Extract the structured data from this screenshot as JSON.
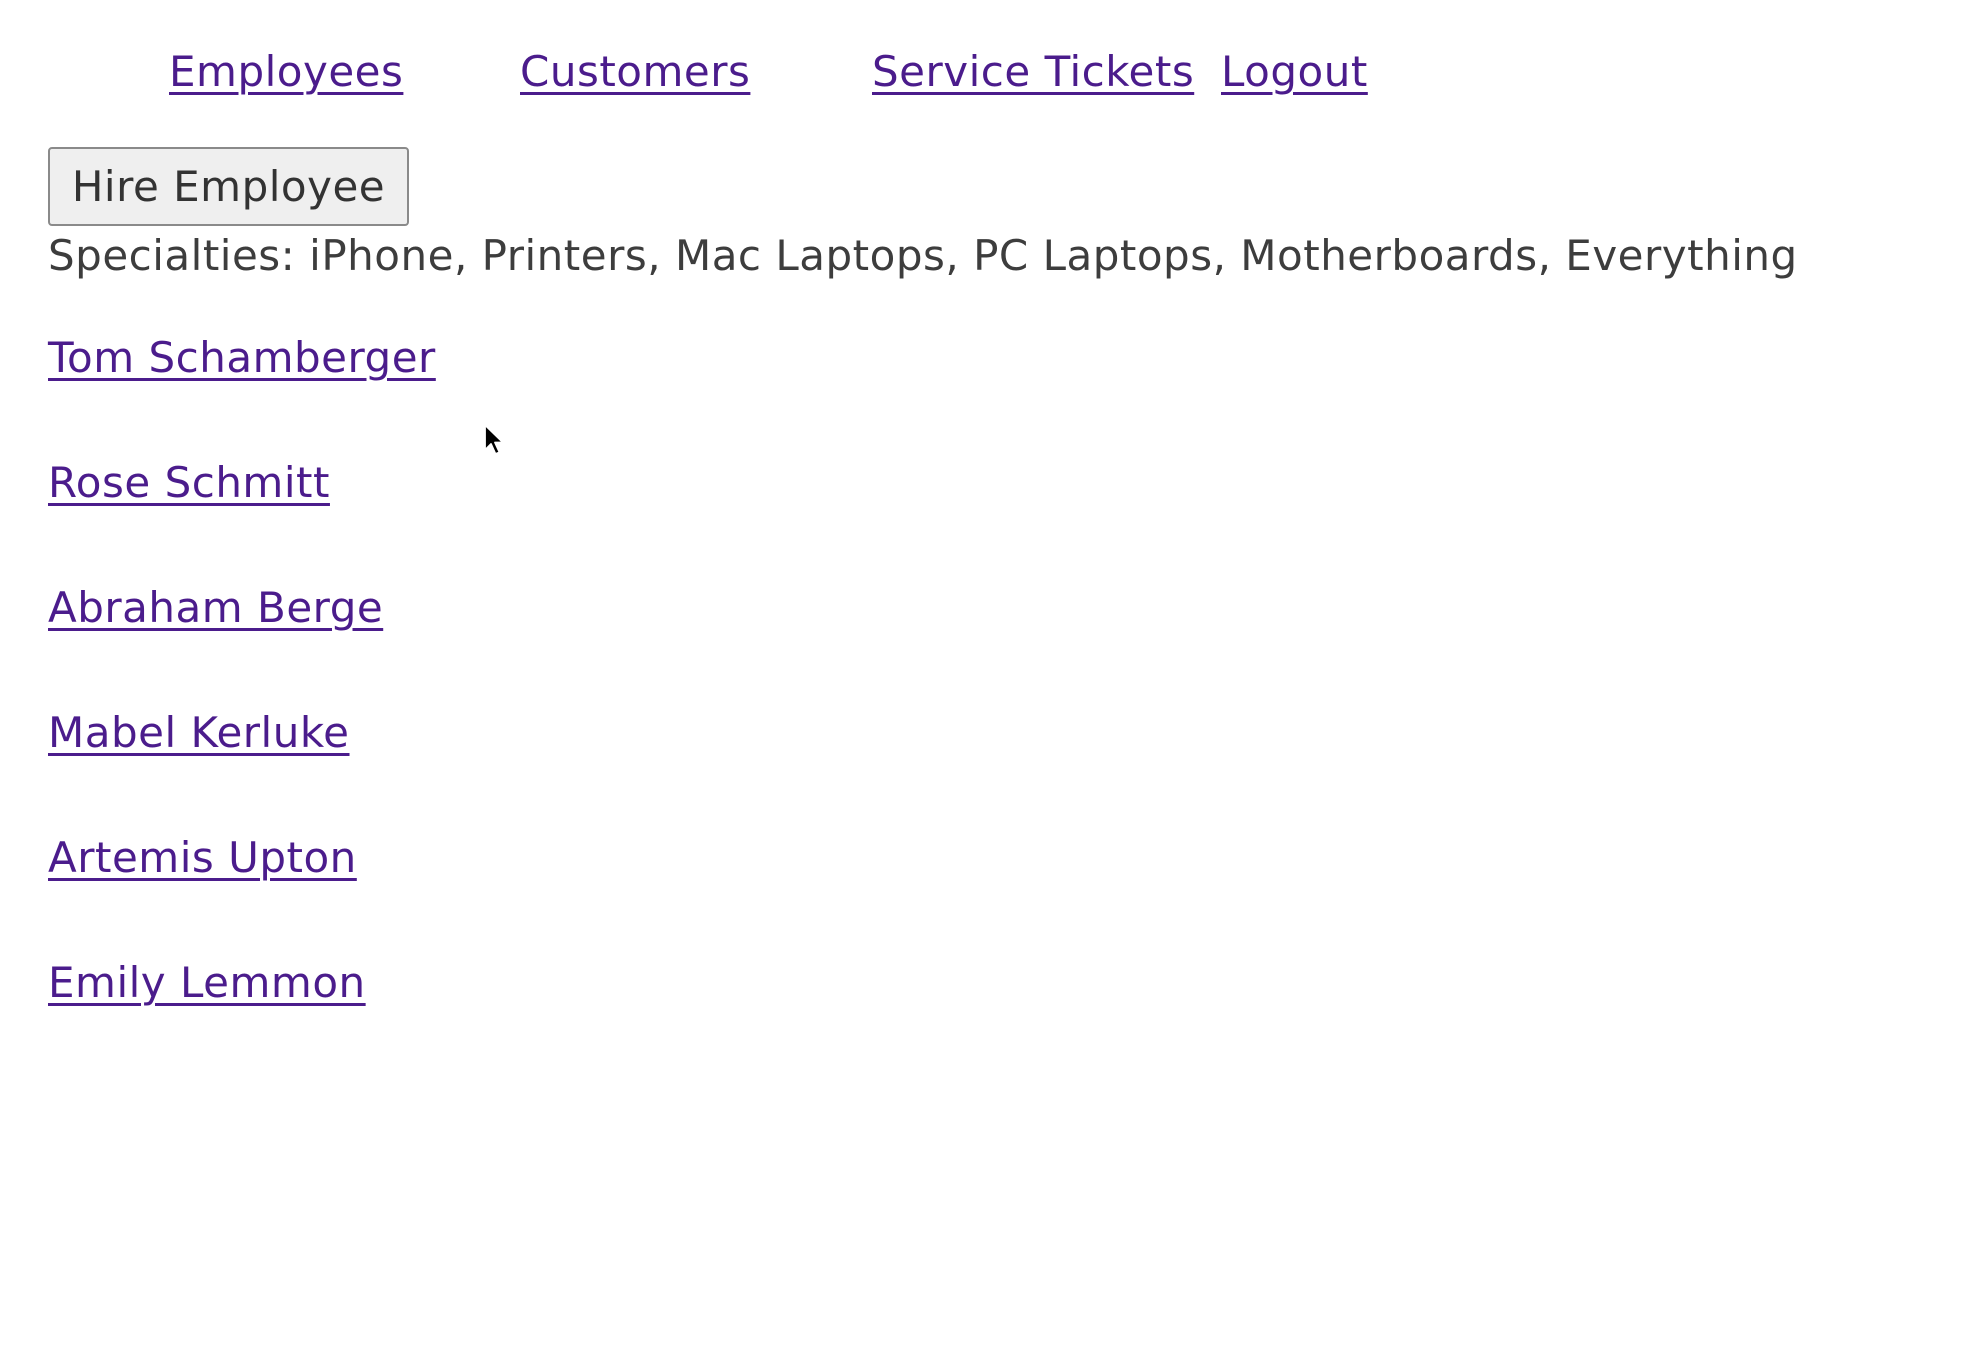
{
  "nav": {
    "employees": "Employees",
    "customers": "Customers",
    "service_tickets": "Service Tickets",
    "logout": "Logout"
  },
  "hire_button": "Hire Employee",
  "specialties_text": "Specialties: iPhone, Printers, Mac Laptops, PC Laptops, Motherboards, Everything",
  "employees": [
    "Tom Schamberger",
    "Rose Schmitt",
    "Abraham Berge",
    "Mabel Kerluke",
    "Artemis Upton",
    "Emily Lemmon"
  ],
  "colors": {
    "link": "#4b1c8c",
    "text": "#3d3d3d",
    "button_bg": "#efefef"
  }
}
